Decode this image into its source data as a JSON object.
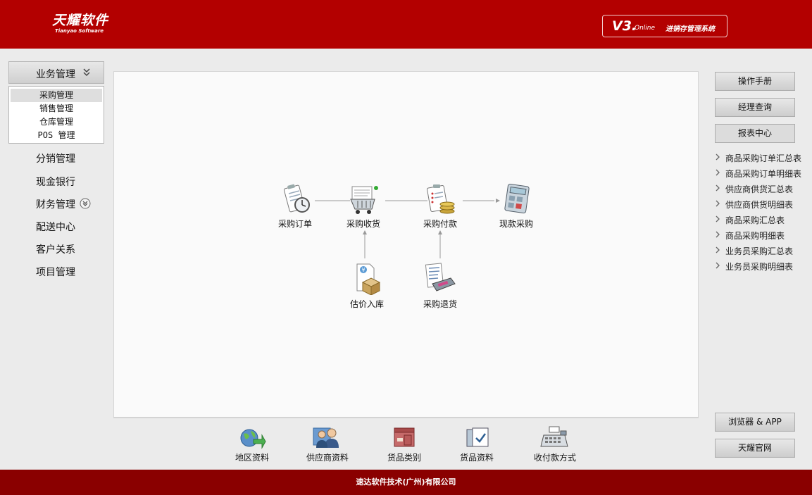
{
  "header": {
    "logo_text": "天耀软件",
    "logo_sub": "Tianyao Software",
    "version": "V3.",
    "version_suffix": "Online",
    "system_name": "进销存管理系统"
  },
  "sidebar": {
    "section_title": "业务管理",
    "submenu": [
      {
        "label": "采购管理",
        "active": true
      },
      {
        "label": "销售管理",
        "active": false
      },
      {
        "label": "仓库管理",
        "active": false
      },
      {
        "label": "POS 管理",
        "active": false
      }
    ],
    "items": [
      {
        "label": "分销管理"
      },
      {
        "label": "现金银行"
      },
      {
        "label": "财务管理"
      },
      {
        "label": "配送中心"
      },
      {
        "label": "客户关系"
      },
      {
        "label": "项目管理"
      }
    ]
  },
  "flow": {
    "nodes": [
      {
        "label": "采购订单",
        "icon": "clipboard-clock-icon"
      },
      {
        "label": "采购收货",
        "icon": "shopping-cart-icon"
      },
      {
        "label": "采购付款",
        "icon": "clipboard-coins-icon"
      },
      {
        "label": "现款采购",
        "icon": "calculator-icon"
      },
      {
        "label": "估价入库",
        "icon": "box-document-icon"
      },
      {
        "label": "采购退货",
        "icon": "card-reader-icon"
      }
    ]
  },
  "quick_links": [
    {
      "label": "地区资料",
      "icon": "globe-arrow-icon"
    },
    {
      "label": "供应商资料",
      "icon": "people-icon"
    },
    {
      "label": "货品类别",
      "icon": "package-icon"
    },
    {
      "label": "货品资料",
      "icon": "checklist-icon"
    },
    {
      "label": "收付款方式",
      "icon": "cash-register-icon"
    }
  ],
  "right_panel": {
    "buttons_top": [
      {
        "label": "操作手册"
      },
      {
        "label": "经理查询"
      },
      {
        "label": "报表中心",
        "active": true
      }
    ],
    "reports": [
      {
        "label": "商品采购订单汇总表"
      },
      {
        "label": "商品采购订单明细表"
      },
      {
        "label": "供应商供货汇总表"
      },
      {
        "label": "供应商供货明细表"
      },
      {
        "label": "商品采购汇总表"
      },
      {
        "label": "商品采购明细表"
      },
      {
        "label": "业务员采购汇总表"
      },
      {
        "label": "业务员采购明细表"
      }
    ],
    "buttons_bottom": [
      {
        "label": "浏览器 & APP"
      },
      {
        "label": "天耀官网"
      }
    ]
  },
  "footer": {
    "company": "速达软件技术(广州)有限公司"
  },
  "colors": {
    "header_red": "#b30000",
    "footer_red": "#8a0000",
    "background": "#ebebeb"
  }
}
